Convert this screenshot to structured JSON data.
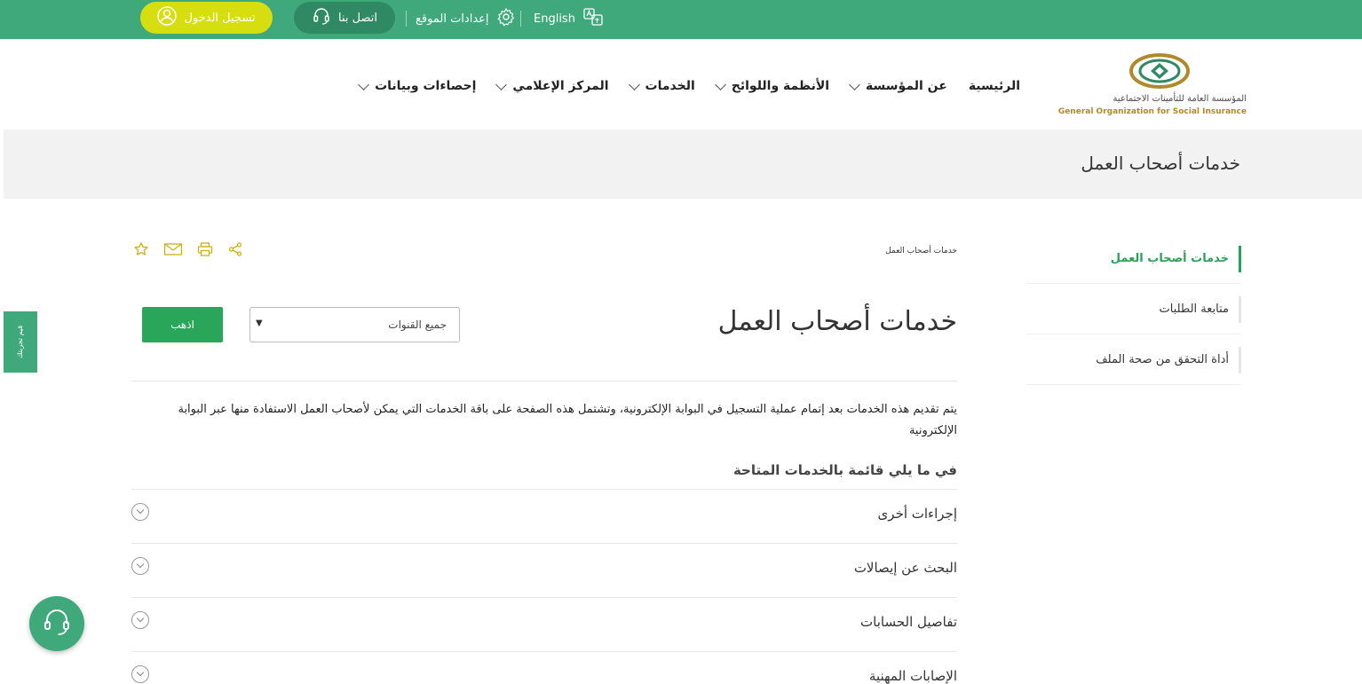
{
  "topbar": {
    "login_label": "تسجيل الدخول",
    "contact_label": "اتصل بنا",
    "settings_label": "إعدادات الموقع",
    "language_label": "English",
    "colors": {
      "bar": "#3fa97c",
      "login": "#d7de10",
      "contact": "#2f8a63"
    }
  },
  "logo": {
    "arabic_name": "المؤسسة العامة للتأمينات الاجتماعية",
    "english_name": "General Organization for Social Insurance"
  },
  "nav": {
    "items": [
      {
        "label": "الرئيسية",
        "has_dropdown": false
      },
      {
        "label": "عن المؤسسة",
        "has_dropdown": true
      },
      {
        "label": "الأنظمة واللوائح",
        "has_dropdown": true
      },
      {
        "label": "الخدمات",
        "has_dropdown": true
      },
      {
        "label": "المركز الإعلامي",
        "has_dropdown": true
      },
      {
        "label": "إحصاءات وبيانات",
        "has_dropdown": true
      }
    ]
  },
  "band": {
    "title": "خدمات أصحاب العمل"
  },
  "sidebar": {
    "items": [
      {
        "label": "خدمات أصحاب العمل",
        "active": true
      },
      {
        "label": "متابعة الطلبات",
        "active": false
      },
      {
        "label": "أداة التحقق من صحة الملف",
        "active": false
      }
    ]
  },
  "content": {
    "breadcrumb": "خدمات أصحاب العمل",
    "heading": "خدمات أصحاب العمل",
    "channel_select": {
      "value": "جميع القنوات"
    },
    "go_label": "اذهب",
    "description": "يتم تقديم هذه الخدمات بعد إتمام عملية التسجيل في البوابة الإلكترونية، وتشتمل هذه الصفحة على باقة الخدمات التي يمكن لأصحاب العمل الاستفادة منها عبر البوابة الإلكترونية",
    "list_title": "في ما يلي قائمة بالخدمات المتاحة",
    "services": [
      {
        "label": "إجراءات أخرى"
      },
      {
        "label": "البحث عن إيصالات"
      },
      {
        "label": "تفاصيل الحسابات"
      },
      {
        "label": "الإصابات المهنية"
      }
    ]
  },
  "floating": {
    "feedback_label": "قيم تجربتك"
  },
  "icons": [
    "user-circle-icon",
    "headset-icon",
    "gear-icon",
    "translate-icon",
    "chevron-down-icon",
    "star-icon",
    "mail-icon",
    "print-icon",
    "share-icon",
    "chevron-circle-icon",
    "support-headset-icon"
  ]
}
